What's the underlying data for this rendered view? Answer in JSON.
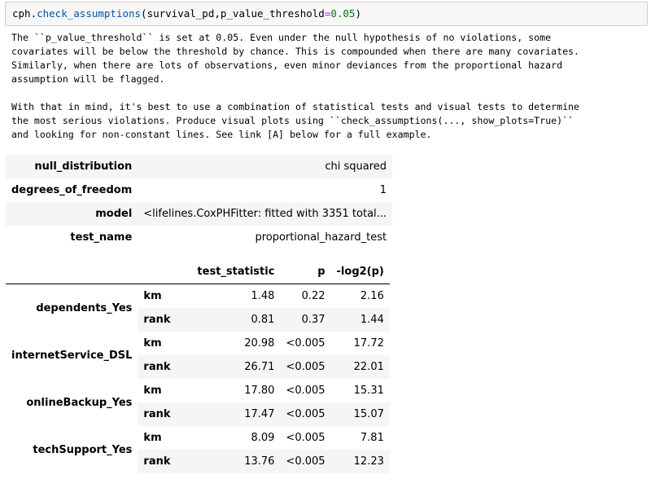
{
  "code_cell": {
    "obj": "cph",
    "dot": ".",
    "method": "check_assumptions",
    "args_open": "(survival_pd,p_value_threshold",
    "eq": "=",
    "threshold": "0.05",
    "args_close": ")"
  },
  "output_text": "The ``p_value_threshold`` is set at 0.05. Even under the null hypothesis of no violations, some\ncovariates will be below the threshold by chance. This is compounded when there are many covariates.\nSimilarly, when there are lots of observations, even minor deviances from the proportional hazard\nassumption will be flagged.\n\nWith that in mind, it's best to use a combination of statistical tests and visual tests to determine\nthe most serious violations. Produce visual plots using ``check_assumptions(..., show_plots=True)``\nand looking for non-constant lines. See link [A] below for a full example.",
  "summary_table": [
    {
      "key": "null_distribution",
      "value": "chi squared"
    },
    {
      "key": "degrees_of_freedom",
      "value": "1"
    },
    {
      "key": "model",
      "value": "<lifelines.CoxPHFitter: fitted with 3351 total..."
    },
    {
      "key": "test_name",
      "value": "proportional_hazard_test"
    }
  ],
  "results_table": {
    "headers": [
      "test_statistic",
      "p",
      "-log2(p)"
    ],
    "rows": [
      {
        "covariate": "dependents_Yes",
        "test": "km",
        "stat": "1.48",
        "p": "0.22",
        "log2p": "2.16"
      },
      {
        "covariate": "",
        "test": "rank",
        "stat": "0.81",
        "p": "0.37",
        "log2p": "1.44"
      },
      {
        "covariate": "internetService_DSL",
        "test": "km",
        "stat": "20.98",
        "p": "<0.005",
        "log2p": "17.72"
      },
      {
        "covariate": "",
        "test": "rank",
        "stat": "26.71",
        "p": "<0.005",
        "log2p": "22.01"
      },
      {
        "covariate": "onlineBackup_Yes",
        "test": "km",
        "stat": "17.80",
        "p": "<0.005",
        "log2p": "15.31"
      },
      {
        "covariate": "",
        "test": "rank",
        "stat": "17.47",
        "p": "<0.005",
        "log2p": "15.07"
      },
      {
        "covariate": "techSupport_Yes",
        "test": "km",
        "stat": "8.09",
        "p": "<0.005",
        "log2p": "7.81"
      },
      {
        "covariate": "",
        "test": "rank",
        "stat": "13.76",
        "p": "<0.005",
        "log2p": "12.23"
      }
    ]
  }
}
